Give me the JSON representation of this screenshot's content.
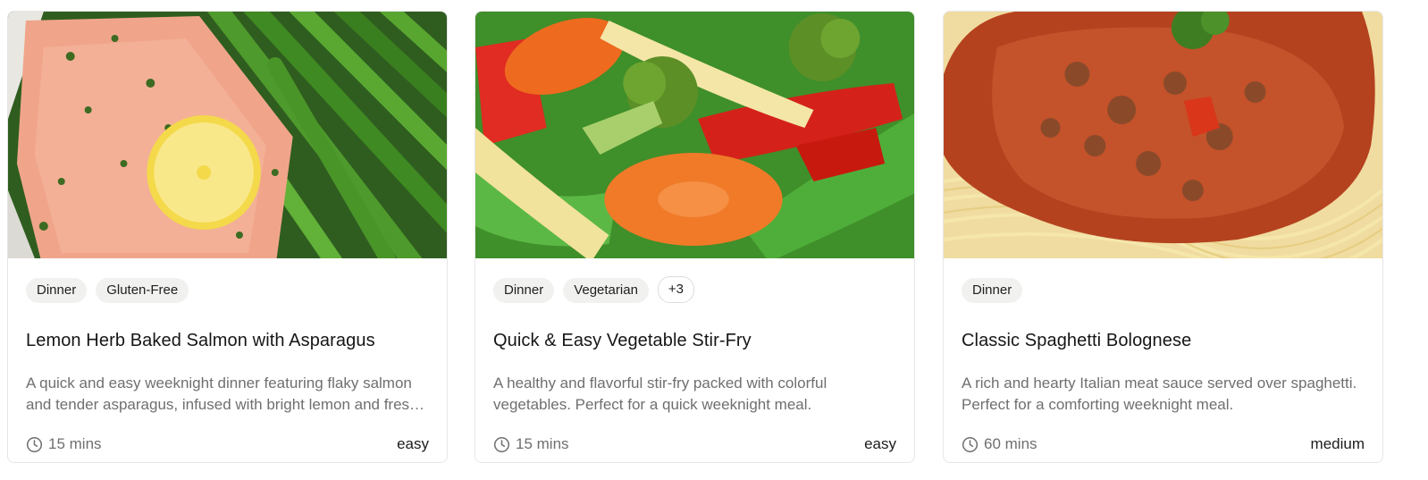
{
  "recipes": [
    {
      "image_icon": "salmon-asparagus-photo",
      "tags": [
        "Dinner",
        "Gluten-Free"
      ],
      "extra_tags": "",
      "title": "Lemon Herb Baked Salmon with Asparagus",
      "description": "A quick and easy weeknight dinner featuring flaky salmon and tender asparagus, infused with bright lemon and fresh herbs.",
      "time": "15 mins",
      "difficulty": "easy"
    },
    {
      "image_icon": "vegetable-stir-fry-photo",
      "tags": [
        "Dinner",
        "Vegetarian"
      ],
      "extra_tags": "+3",
      "title": "Quick & Easy Vegetable Stir-Fry",
      "description": "A healthy and flavorful stir-fry packed with colorful vegetables. Perfect for a quick weeknight meal.",
      "time": "15 mins",
      "difficulty": "easy"
    },
    {
      "image_icon": "spaghetti-bolognese-photo",
      "tags": [
        "Dinner"
      ],
      "extra_tags": "",
      "title": "Classic Spaghetti Bolognese",
      "description": "A rich and hearty Italian meat sauce served over spaghetti. Perfect for a comforting weeknight meal.",
      "time": "60 mins",
      "difficulty": "medium"
    }
  ],
  "icons": {
    "time": "clock-icon"
  },
  "colors": {
    "card_border": "#e6e6e6",
    "tag_bg": "#f1f1f0",
    "muted_text": "#6f6f6f",
    "title_text": "#161616"
  }
}
